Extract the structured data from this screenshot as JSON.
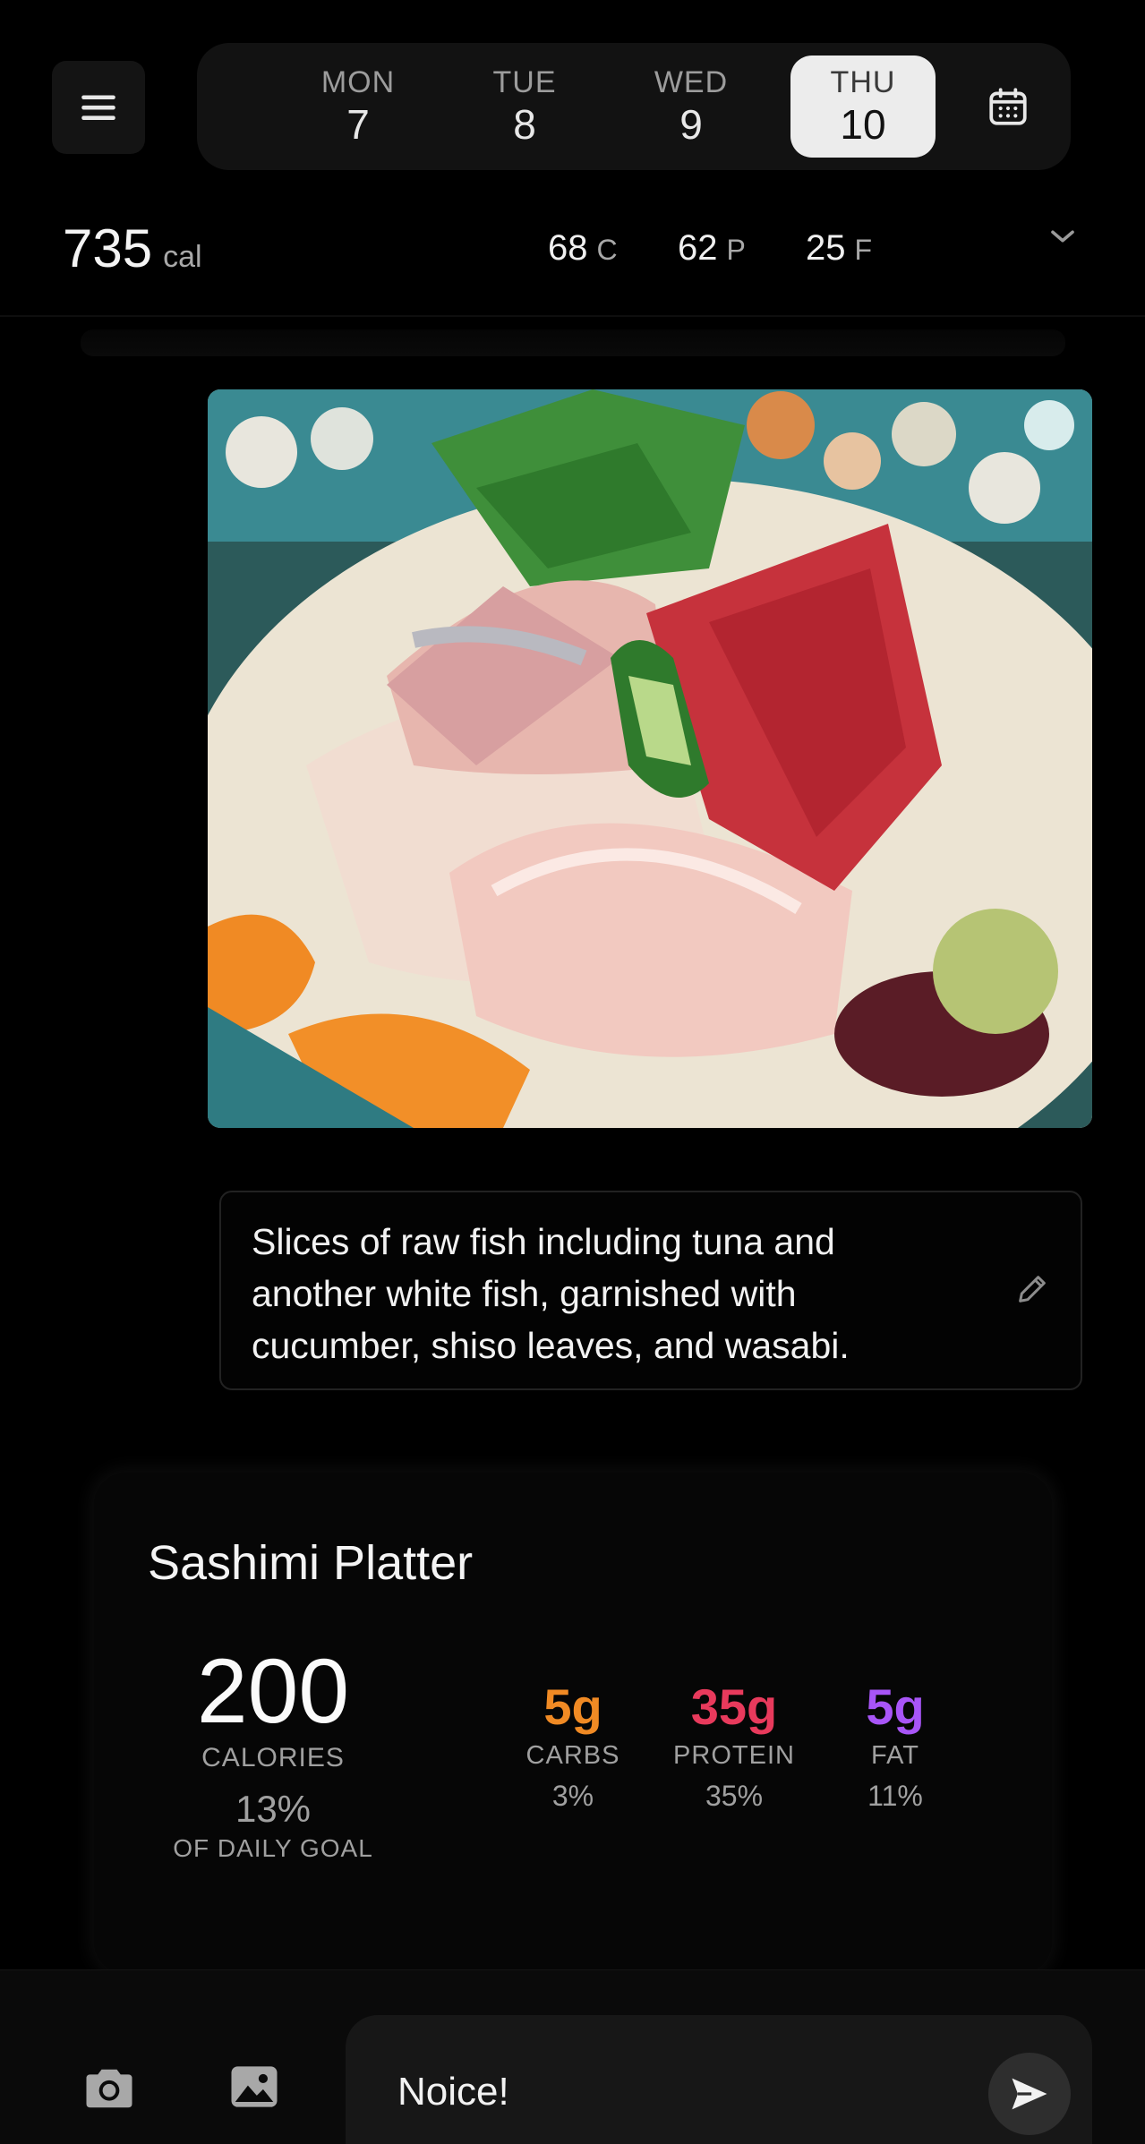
{
  "header": {
    "menu_icon": "hamburger-menu-icon",
    "calendar_icon": "calendar-icon",
    "days": [
      {
        "name": "MON",
        "num": "7"
      },
      {
        "name": "TUE",
        "num": "8"
      },
      {
        "name": "WED",
        "num": "9"
      },
      {
        "name": "THU",
        "num": "10",
        "selected": true
      }
    ]
  },
  "summary": {
    "calories": "735",
    "calories_unit": "cal",
    "carbs": "68",
    "carbs_label": "C",
    "protein": "62",
    "protein_label": "P",
    "fat": "25",
    "fat_label": "F",
    "expand_icon": "chevron-down-icon"
  },
  "entry": {
    "photo_alt": "sashimi-photo",
    "description": "Slices of raw fish including tuna and another white fish, garnished with cucumber, shiso leaves, and wasabi.",
    "edit_icon": "pencil-icon"
  },
  "meal": {
    "title": "Sashimi Platter",
    "calories": "200",
    "calories_label": "CALORIES",
    "goal_pct": "13%",
    "goal_label": "OF DAILY GOAL",
    "macros": [
      {
        "value": "5g",
        "label": "CARBS",
        "pct": "3%",
        "color": "#f08a24"
      },
      {
        "value": "35g",
        "label": "PROTEIN",
        "pct": "35%",
        "color": "#e83a5c"
      },
      {
        "value": "5g",
        "label": "FAT",
        "pct": "11%",
        "color": "#a855f7"
      }
    ]
  },
  "composer": {
    "camera_icon": "camera-icon",
    "image_icon": "image-icon",
    "input_value": "Noice!",
    "send_icon": "send-icon"
  }
}
